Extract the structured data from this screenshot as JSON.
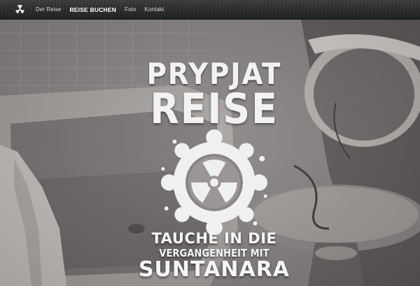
{
  "nav": {
    "logo_icon": "radiation-icon",
    "links": [
      {
        "label": "Der Reise",
        "active": false
      },
      {
        "label": "REISE BUCHEN",
        "active": true
      },
      {
        "label": "Foto",
        "active": false
      },
      {
        "label": "Kontakt",
        "active": false
      }
    ]
  },
  "hero": {
    "title_line1": "PRYPJAT",
    "title_line2": "REISE",
    "emblem_icon": "radiation-gear-icon",
    "tagline_line1": "TAUCHE IN DIE",
    "tagline_line2": "VERGANGENHEIT MIT",
    "tagline_line3": "SUNTANARA"
  },
  "colors": {
    "navbar": "#2a2b2d",
    "nav_text": "#d8d8d8",
    "hero_text": "#f2f2f2"
  }
}
